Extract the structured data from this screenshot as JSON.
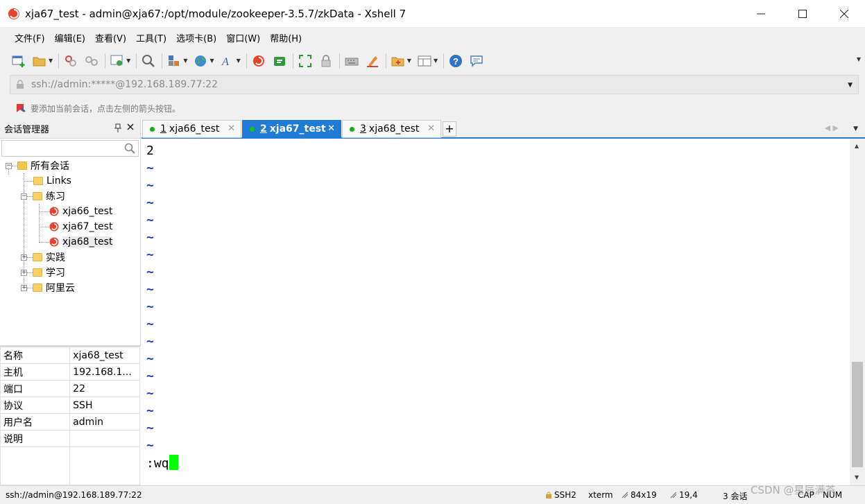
{
  "window": {
    "title": "xja67_test - admin@xja67:/opt/module/zookeeper-3.5.7/zkData - Xshell 7",
    "minimize": "—",
    "maximize": "☐",
    "close": "✕"
  },
  "menubar": {
    "items": [
      "文件(F)",
      "编辑(E)",
      "查看(V)",
      "工具(T)",
      "选项卡(B)",
      "窗口(W)",
      "帮助(H)"
    ]
  },
  "address": {
    "value": "ssh://admin:*****@192.168.189.77:22"
  },
  "hint": {
    "text": "要添加当前会话，点击左侧的箭头按钮。"
  },
  "session_manager": {
    "title": "会话管理器",
    "pin": "📌",
    "close": "✕",
    "tree": {
      "root": "所有会话",
      "links": "Links",
      "practice": "练习",
      "sessions": [
        "xja66_test",
        "xja67_test",
        "xja68_test"
      ],
      "practice2": "实践",
      "study": "学习",
      "aliyun": "阿里云"
    }
  },
  "properties": {
    "rows": [
      {
        "key": "名称",
        "value": "xja68_test"
      },
      {
        "key": "主机",
        "value": "192.168.1..."
      },
      {
        "key": "端口",
        "value": "22"
      },
      {
        "key": "协议",
        "value": "SSH"
      },
      {
        "key": "用户名",
        "value": "admin"
      },
      {
        "key": "说明",
        "value": ""
      }
    ]
  },
  "tabs": [
    {
      "num": "1",
      "label": "xja66_test",
      "close": "✕"
    },
    {
      "num": "2",
      "label": "xja67_test",
      "close": "✕"
    },
    {
      "num": "3",
      "label": "xja68_test",
      "close": "✕"
    }
  ],
  "tab_add": "+",
  "terminal": {
    "first_line": "2",
    "tilde": "~",
    "command": ":wq"
  },
  "statusbar": {
    "connection": "ssh://admin@192.168.189.77:22",
    "protocol": "SSH2",
    "term": "xterm",
    "size": "84x19",
    "position": "19,4",
    "sessions": "3 会话",
    "caps": "CAP",
    "num": "NUM",
    "watermark": "CSDN @星辰满茶"
  },
  "colors": {
    "accent": "#1f7bd6",
    "online": "#14b014",
    "cursor": "#00ff00",
    "tilde": "#1a3ec9"
  }
}
